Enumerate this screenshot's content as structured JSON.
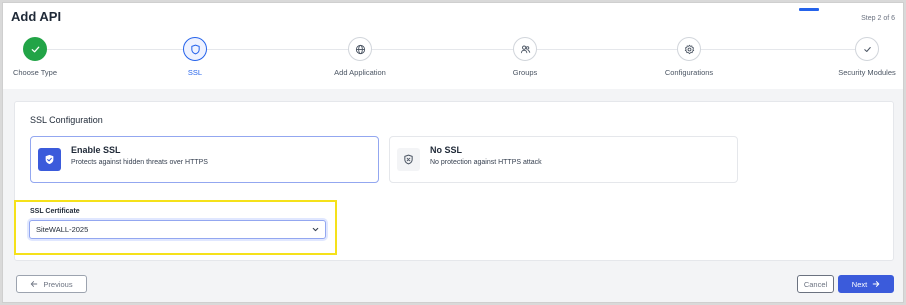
{
  "header": {
    "title": "Add API",
    "step_counter": "Step 2 of 6"
  },
  "stepper": {
    "steps": [
      {
        "label": "Choose Type",
        "icon": "check-icon",
        "state": "done"
      },
      {
        "label": "SSL",
        "icon": "shield-icon",
        "state": "active"
      },
      {
        "label": "Add Application",
        "icon": "globe-icon",
        "state": "pending"
      },
      {
        "label": "Groups",
        "icon": "users-icon",
        "state": "pending"
      },
      {
        "label": "Configurations",
        "icon": "gear-icon",
        "state": "pending"
      },
      {
        "label": "Security Modules",
        "icon": "check-icon",
        "state": "pending"
      }
    ]
  },
  "ssl_config": {
    "title": "SSL Configuration",
    "options": [
      {
        "title": "Enable SSL",
        "description": "Protects against hidden threats over HTTPS",
        "icon": "shield-check-icon",
        "selected": true
      },
      {
        "title": "No SSL",
        "description": "No protection against HTTPS attack",
        "icon": "shield-x-icon",
        "selected": false
      }
    ],
    "certificate": {
      "label": "SSL Certificate",
      "value": "SiteWALL-2025"
    }
  },
  "footer": {
    "previous_label": "Previous",
    "cancel_label": "Cancel",
    "next_label": "Next"
  },
  "colors": {
    "accent": "#3b5bdb",
    "success": "#22a447",
    "highlight": "#f5e11a"
  }
}
